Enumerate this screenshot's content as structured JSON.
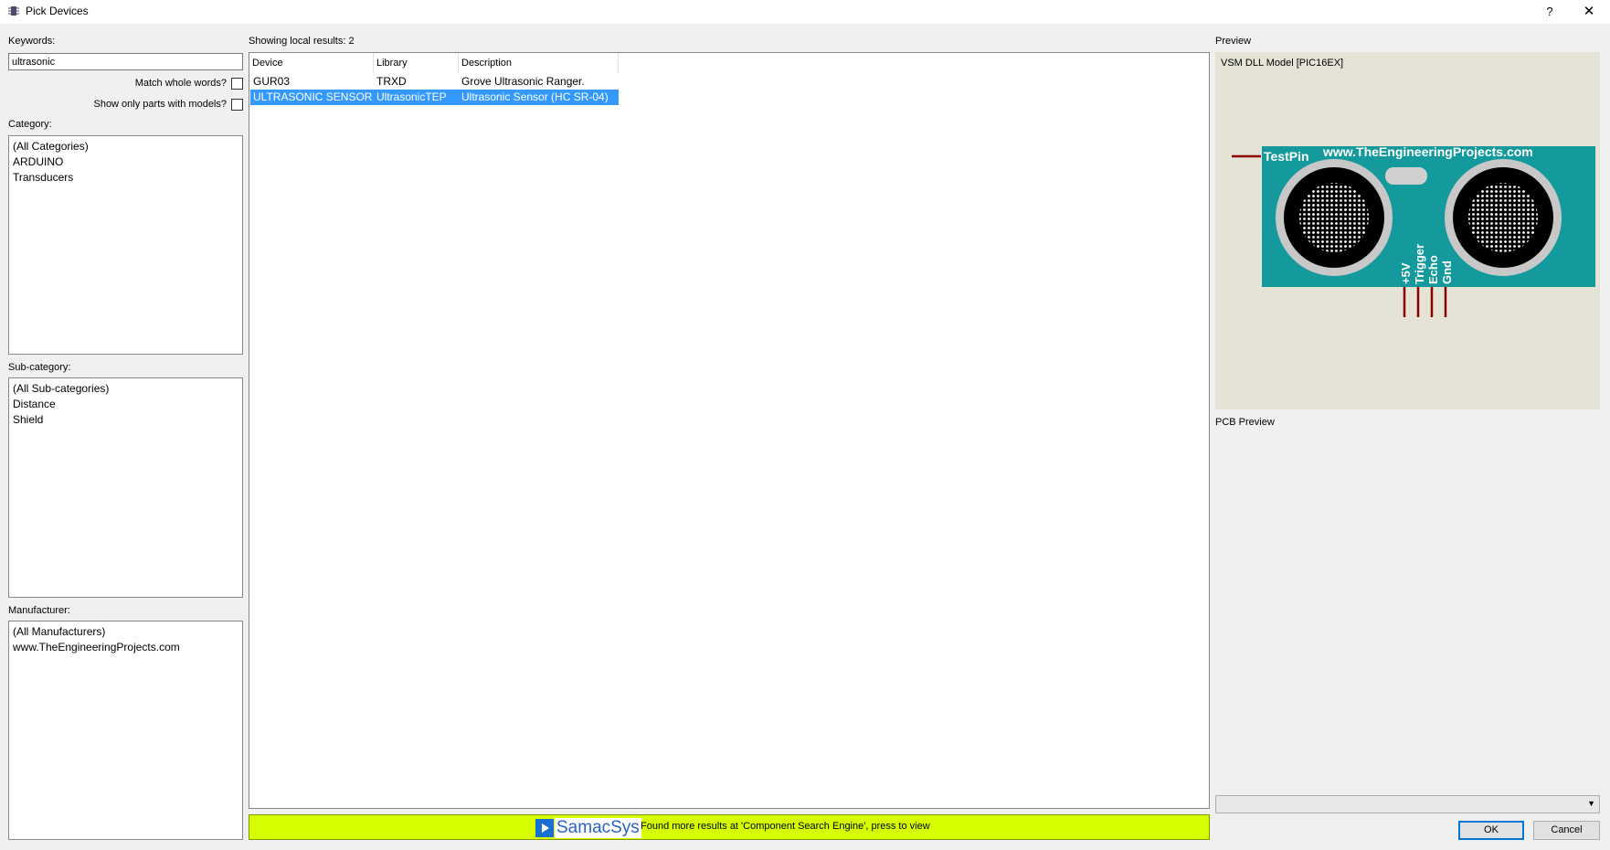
{
  "window": {
    "title": "Pick Devices",
    "help": "?",
    "close": "✕"
  },
  "keywords": {
    "label": "Keywords:",
    "value": "ultrasonic",
    "match_whole_words": "Match whole words?",
    "show_only_models": "Show only parts with models?"
  },
  "category": {
    "label": "Category:",
    "items": [
      "(All Categories)",
      "ARDUINO",
      "Transducers"
    ]
  },
  "subcategory": {
    "label": "Sub-category:",
    "items": [
      "(All Sub-categories)",
      "Distance",
      "Shield"
    ]
  },
  "manufacturer": {
    "label": "Manufacturer:",
    "items": [
      "(All Manufacturers)",
      "www.TheEngineeringProjects.com"
    ]
  },
  "results": {
    "summary": "Showing local results: 2",
    "columns": [
      "Device",
      "Library",
      "Description"
    ],
    "rows": [
      {
        "device": "GUR03",
        "library": "TRXD",
        "description": "Grove Ultrasonic Ranger.",
        "selected": false
      },
      {
        "device": "ULTRASONIC SENSOR",
        "library": "UltrasonicTEP",
        "description": "Ultrasonic Sensor (HC SR-04)",
        "selected": true
      }
    ]
  },
  "samacsys": {
    "logo": "SamacSys",
    "message": "Found more results at 'Component Search Engine', press to view"
  },
  "preview": {
    "label": "Preview",
    "model": "VSM DLL Model [PIC16EX]",
    "testpin": "TestPin",
    "website": "www.TheEngineeringProjects.com",
    "pins": [
      "+5V",
      "Trigger",
      "Echo",
      "Gnd"
    ],
    "colors": {
      "board": "#14999c",
      "wire": "#8b0000",
      "background": "#e4e3d6"
    }
  },
  "pcb_preview": {
    "label": "PCB Preview"
  },
  "buttons": {
    "ok": "OK",
    "cancel": "Cancel"
  },
  "icons": {
    "app": "chip-icon",
    "dropdown": "chevron-down-icon"
  }
}
